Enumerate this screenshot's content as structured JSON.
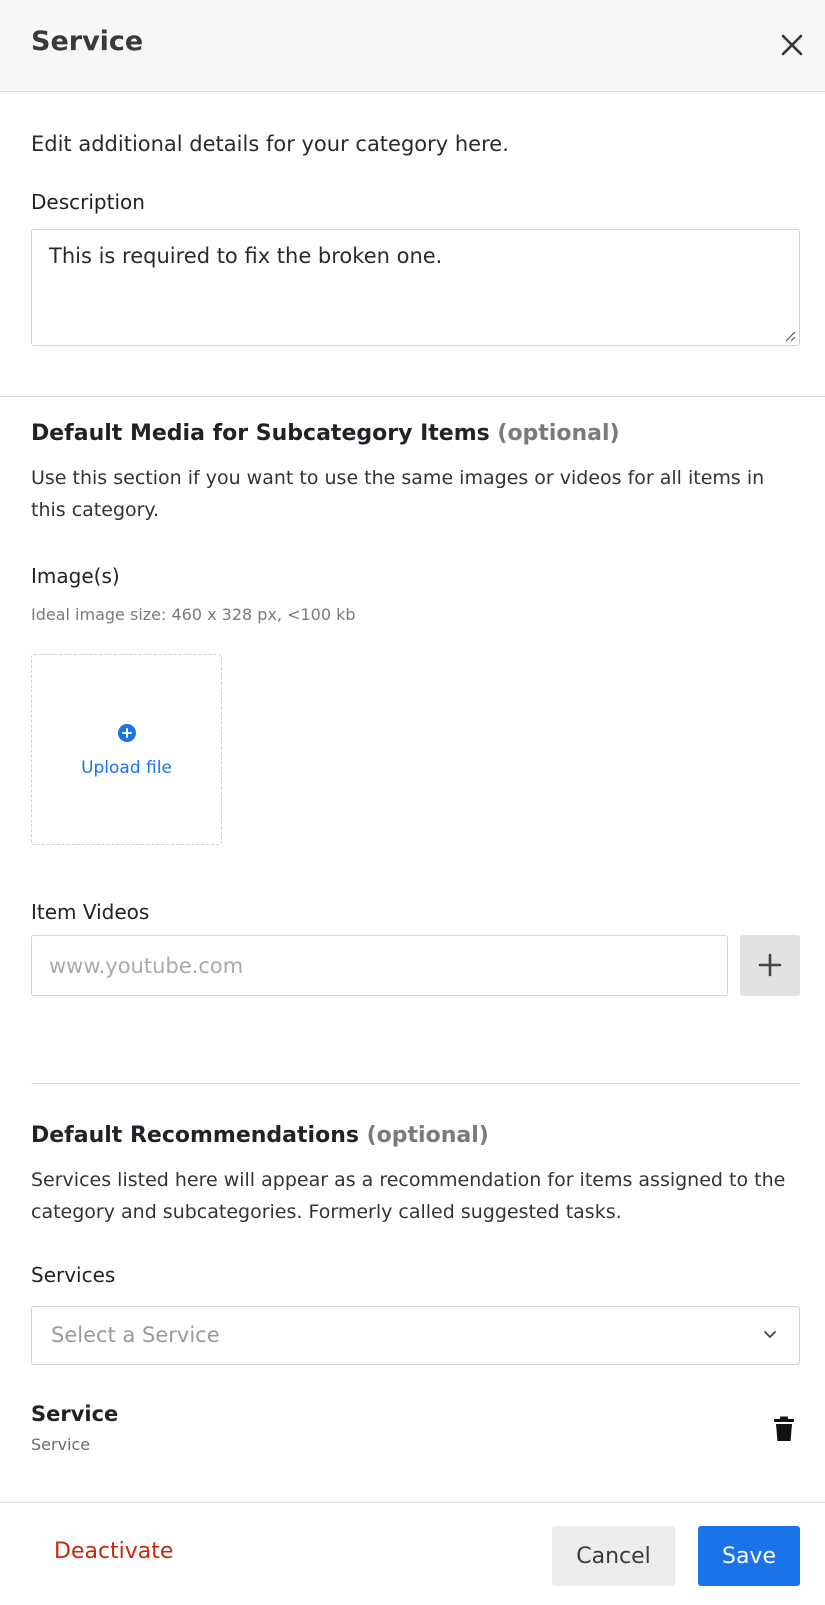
{
  "header": {
    "title": "Service",
    "close_icon": "close-icon"
  },
  "intro": "Edit additional details for your category here.",
  "description": {
    "label": "Description",
    "value": "This is required to fix the broken one."
  },
  "media": {
    "title": "Default Media for Subcategory Items",
    "optional": "(optional)",
    "desc": "Use this section if you want to use the same images or videos for all items in this category.",
    "images_label": "Image(s)",
    "hint": "Ideal image size: 460 x 328 px, <100 kb",
    "upload_label": "Upload file",
    "videos_label": "Item Videos",
    "video_placeholder": "www.youtube.com"
  },
  "recommendations": {
    "title": "Default Recommendations",
    "optional": "(optional)",
    "desc": "Services listed here will appear as a recommendation for items assigned to the category and subcategories. Formerly called suggested tasks.",
    "services_label": "Services",
    "select_placeholder": "Select a Service",
    "item_name": "Service",
    "item_sub": "Service"
  },
  "footer": {
    "deactivate": "Deactivate",
    "cancel": "Cancel",
    "save": "Save"
  },
  "colors": {
    "accent": "#1a73e8",
    "danger": "#c5280c"
  }
}
